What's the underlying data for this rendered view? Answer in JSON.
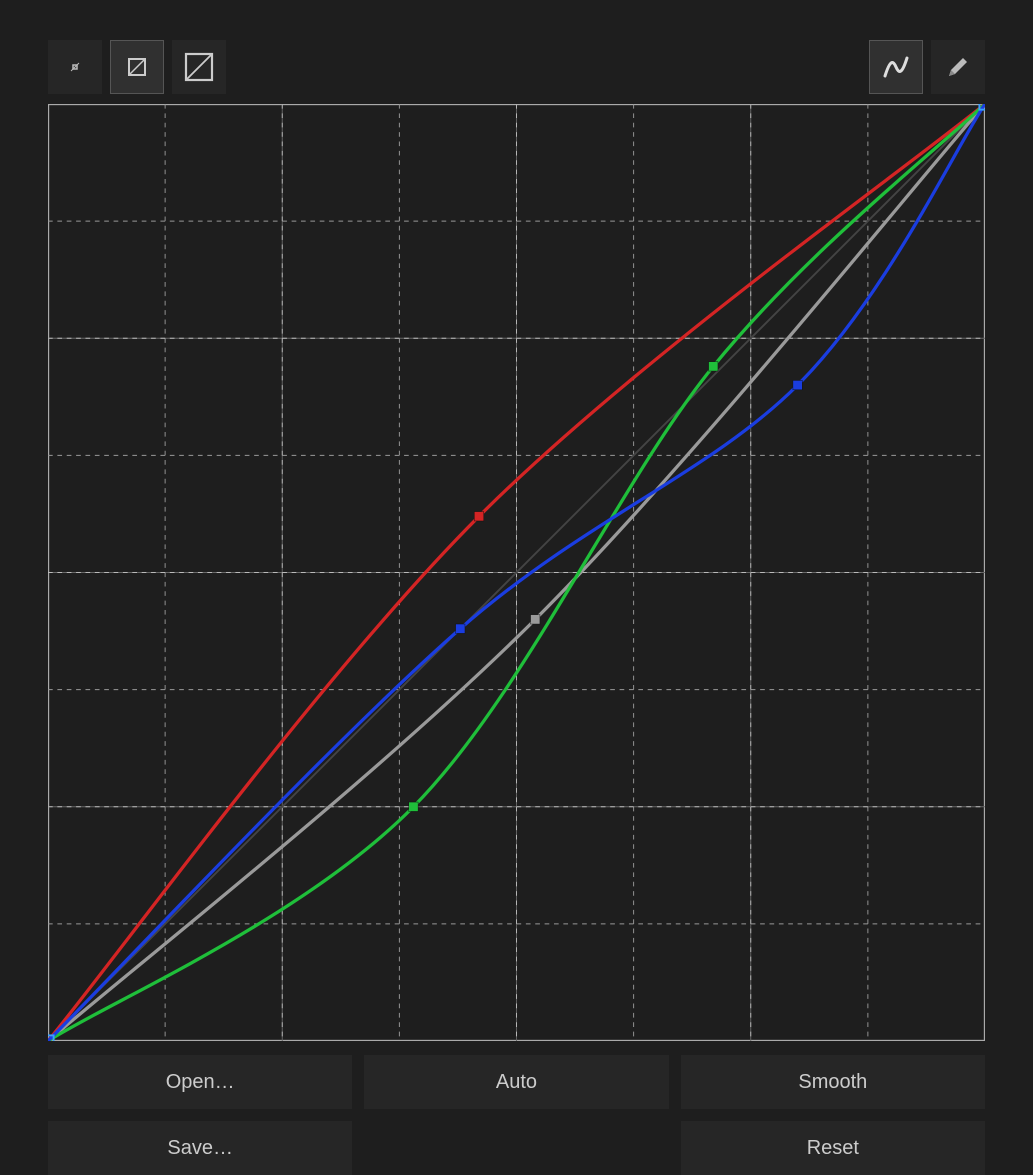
{
  "toolbar": {
    "thumb_small": "small-thumb",
    "thumb_medium": "medium-thumb",
    "thumb_large": "large-thumb",
    "curve_mode": "curve-mode",
    "pencil_mode": "pencil-mode",
    "selected": "medium-thumb"
  },
  "buttons": {
    "open": "Open…",
    "auto": "Auto",
    "smooth": "Smooth",
    "save": "Save…",
    "reset": "Reset"
  },
  "chart_data": {
    "type": "line",
    "title": "",
    "xlabel": "",
    "ylabel": "",
    "xlim": [
      0,
      1
    ],
    "ylim": [
      0,
      1
    ],
    "grid": {
      "major_v": [
        0.25,
        0.5,
        0.75
      ],
      "major_h": [
        0.25,
        0.5,
        0.75
      ],
      "minor_v": [
        0.125,
        0.375,
        0.625,
        0.875
      ],
      "minor_h": [
        0.125,
        0.375,
        0.625,
        0.875
      ]
    },
    "diagonal": [
      [
        0,
        0
      ],
      [
        1,
        1
      ]
    ],
    "series": [
      {
        "name": "luminance",
        "color": "#9a9a9a",
        "points": [
          [
            0,
            0
          ],
          [
            0.52,
            0.45
          ],
          [
            1,
            1
          ]
        ],
        "draw": "catmull"
      },
      {
        "name": "red",
        "color": "#d42424",
        "points": [
          [
            0,
            0
          ],
          [
            0.46,
            0.56
          ],
          [
            1,
            1
          ]
        ],
        "draw": "catmull"
      },
      {
        "name": "green",
        "color": "#1fbf3a",
        "points": [
          [
            0,
            0
          ],
          [
            0.39,
            0.25
          ],
          [
            0.71,
            0.72
          ],
          [
            1,
            1
          ]
        ],
        "draw": "catmull"
      },
      {
        "name": "blue",
        "color": "#1a3de0",
        "points": [
          [
            0,
            0
          ],
          [
            0.44,
            0.44
          ],
          [
            0.8,
            0.7
          ],
          [
            1,
            1
          ]
        ],
        "draw": "catmull"
      }
    ],
    "corner_markers": {
      "color": "#3aa0ff",
      "points": [
        [
          0,
          0
        ],
        [
          1,
          1
        ]
      ]
    }
  }
}
